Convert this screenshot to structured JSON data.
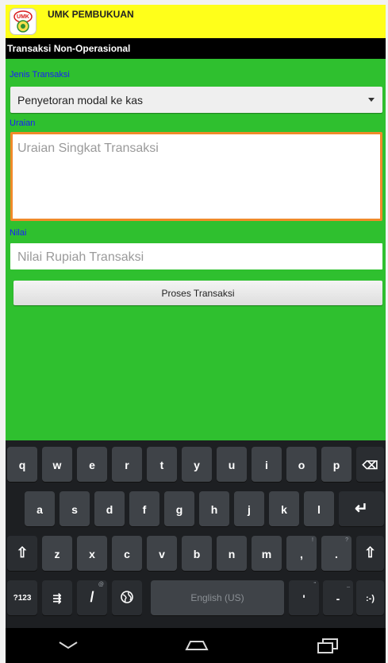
{
  "app": {
    "title": "UMK PEMBUKUAN",
    "logo_text": "UMK"
  },
  "header": {
    "title": "Transaksi Non-Operasional"
  },
  "form": {
    "jenis_label": "Jenis Transaksi",
    "jenis_value": "Penyetoran modal ke kas",
    "uraian_label": "Uraian",
    "uraian_placeholder": "Uraian Singkat Transaksi",
    "nilai_label": "Nilai",
    "nilai_placeholder": "Nilai Rupiah Transaksi",
    "submit_label": "Proses Transaksi"
  },
  "keyboard": {
    "row1": [
      "q",
      "w",
      "e",
      "r",
      "t",
      "y",
      "u",
      "i",
      "o",
      "p"
    ],
    "row2": [
      "a",
      "s",
      "d",
      "f",
      "g",
      "h",
      "j",
      "k",
      "l"
    ],
    "row3": [
      "z",
      "x",
      "c",
      "v",
      "b",
      "n",
      "m",
      ",",
      "."
    ],
    "row3_hints": [
      "",
      "",
      "",
      "",
      "",
      "",
      "",
      "!",
      "?"
    ],
    "symbols_label": "?123",
    "settings_glyph": "⇶",
    "slash_label": "/",
    "slash_hint": "@",
    "space_label": "English (US)",
    "apostrophe_label": "'",
    "apostrophe_hint": "\"",
    "dash_label": "-",
    "dash_hint": "_",
    "smiley_label": ":-)",
    "backspace_glyph": "⌫",
    "enter_glyph": "↵",
    "shift_glyph": "⇧"
  },
  "colors": {
    "background": "#2fc02f",
    "titlebar": "#ffff1a",
    "label": "#1a1aff",
    "focus_border": "#f08a2a"
  }
}
